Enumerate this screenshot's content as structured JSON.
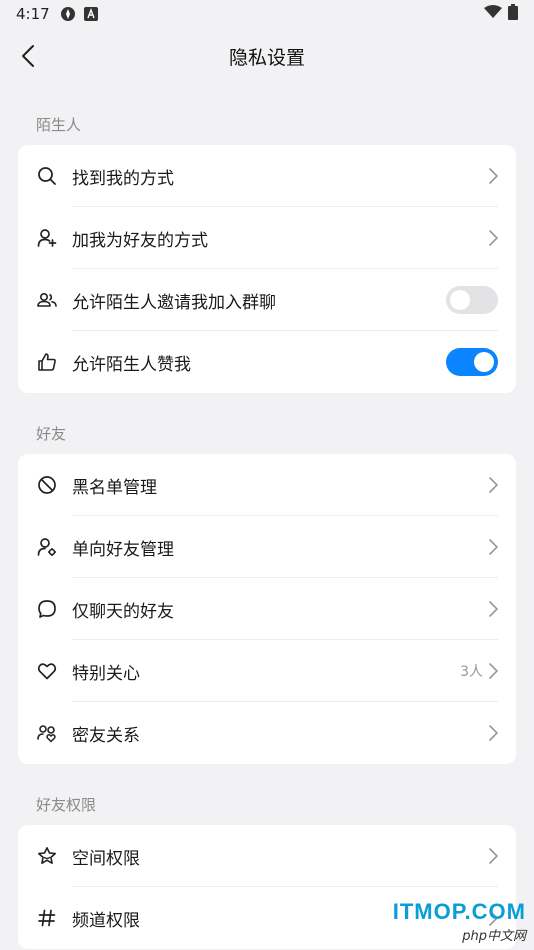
{
  "status_bar": {
    "time": "4:17"
  },
  "nav": {
    "title": "隐私设置"
  },
  "sections": [
    {
      "label": "陌生人",
      "items": [
        {
          "label": "找到我的方式",
          "icon": "search-icon",
          "type": "link"
        },
        {
          "label": "加我为好友的方式",
          "icon": "add-user-icon",
          "type": "link"
        },
        {
          "label": "允许陌生人邀请我加入群聊",
          "icon": "group-icon",
          "type": "toggle",
          "value": false
        },
        {
          "label": "允许陌生人赞我",
          "icon": "thumbs-up-icon",
          "type": "toggle",
          "value": true
        }
      ]
    },
    {
      "label": "好友",
      "items": [
        {
          "label": "黑名单管理",
          "icon": "block-icon",
          "type": "link"
        },
        {
          "label": "单向好友管理",
          "icon": "user-settings-icon",
          "type": "link"
        },
        {
          "label": "仅聊天的好友",
          "icon": "chat-bubble-icon",
          "type": "link"
        },
        {
          "label": "特别关心",
          "icon": "heart-icon",
          "type": "link",
          "meta": "3人"
        },
        {
          "label": "密友关系",
          "icon": "close-friends-icon",
          "type": "link"
        }
      ]
    },
    {
      "label": "好友权限",
      "items": [
        {
          "label": "空间权限",
          "icon": "star-outline-icon",
          "type": "link"
        },
        {
          "label": "频道权限",
          "icon": "hashtag-icon",
          "type": "link"
        }
      ]
    }
  ],
  "watermark": {
    "main": "ITMOP.COM",
    "sub": "php中文网"
  },
  "colors": {
    "accent": "#0a84ff",
    "background": "#f2f2f4"
  }
}
